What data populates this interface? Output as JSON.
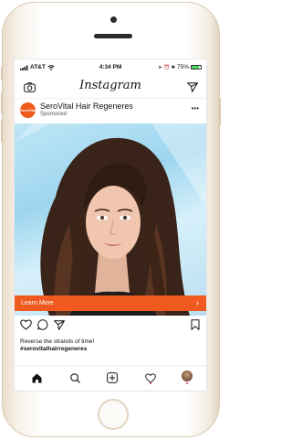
{
  "status": {
    "carrier": "AT&T",
    "time": "4:34 PM",
    "battery": "75%",
    "battery_level": 0.75
  },
  "header": {
    "logo": "Instagram"
  },
  "post": {
    "account_name": "SeroVital Hair Regeneres",
    "sponsored": "Sponsored",
    "avatar_text": "SeroVital",
    "cta_label": "Learn More",
    "caption": "Reverse the strands of time!",
    "hashtag": "#serovitalhairregeneres"
  },
  "icons": {
    "camera": "camera-icon",
    "send": "direct-send-icon",
    "more": "more-icon",
    "like": "heart-icon",
    "comment": "comment-icon",
    "share": "share-icon",
    "save": "bookmark-icon",
    "home": "home-icon",
    "search": "search-icon",
    "add": "add-post-icon",
    "activity": "activity-heart-icon",
    "profile": "profile-avatar"
  },
  "colors": {
    "brand_orange": "#f05a1e",
    "notification_dot": "#e0245e"
  }
}
